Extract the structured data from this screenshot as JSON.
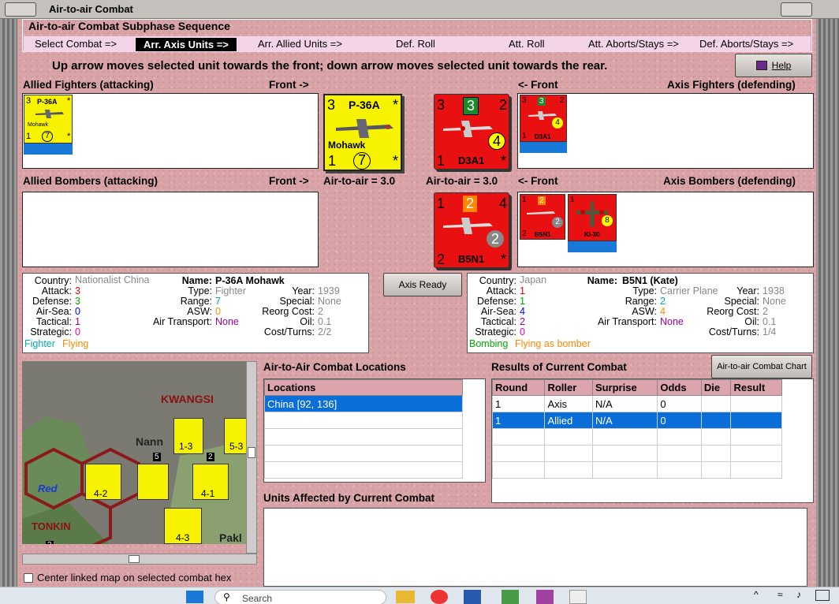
{
  "window": {
    "title": "Air-to-air Combat"
  },
  "sequence": {
    "title": "Air-to-air Combat Subphase Sequence",
    "steps": [
      "Select Combat =>",
      "Arr. Axis Units =>",
      "Arr. Allied Units =>",
      "Def. Roll",
      "Att. Roll",
      "Att. Aborts/Stays =>",
      "Def. Aborts/Stays =>"
    ],
    "active_step": "Arr. Axis Units =>"
  },
  "instructions": "Up arrow moves selected unit towards the front; down arrow moves selected unit towards the rear.",
  "help_button": "Help",
  "allied_fighters": {
    "label": "Allied Fighters (attacking)",
    "front": "Front ->"
  },
  "axis_fighters": {
    "label": "Axis Fighters (defending)",
    "front": "<- Front"
  },
  "allied_bombers": {
    "label": "Allied Bombers (attacking)",
    "front": "Front ->"
  },
  "axis_bombers": {
    "label": "Axis Bombers (defending)",
    "front": "<- Front"
  },
  "air_to_air_left": "Air-to-air = 3.0",
  "air_to_air_right": "Air-to-air = 3.0",
  "axis_ready_button": "Axis Ready",
  "chart_button": "Air-to-air Combat Chart",
  "units": {
    "p36a": {
      "attack": "3",
      "name": "P-36A",
      "star": "*",
      "nickname": "Mohawk",
      "bottom_left": "1",
      "range": "7"
    },
    "d3a1": {
      "top_left": "3",
      "green": "3",
      "top_right": "2",
      "yellow": "4",
      "bottom_left": "1",
      "name": "D3A1",
      "star": "*"
    },
    "b5n1": {
      "top_left": "1",
      "orange": "2",
      "top_right": "4",
      "grey": "2",
      "bottom_left": "2",
      "name": "B5N1",
      "star": "*"
    },
    "ki30": {
      "top_left": "1",
      "yellow": "8",
      "name": "Ki-30"
    }
  },
  "allied_info": {
    "labels": {
      "country": "Country:",
      "attack": "Attack:",
      "defense": "Defense:",
      "airsea": "Air-Sea:",
      "tactical": "Tactical:",
      "strategic": "Strategic:",
      "name": "Name:",
      "type": "Type:",
      "range": "Range:",
      "asw": "ASW:",
      "airtransport": "Air Transport:",
      "year": "Year:",
      "special": "Special:",
      "reorg": "Reorg Cost:",
      "oil": "Oil:",
      "cost": "Cost/Turns:"
    },
    "country": "Nationalist China",
    "attack": "3",
    "defense": "3",
    "airsea": "0",
    "tactical": "1",
    "strategic": "0",
    "name": "P-36A Mohawk",
    "type": "Fighter",
    "range": "7",
    "asw": "0",
    "airtransport": "None",
    "year": "1939",
    "special": "None",
    "reorg": "2",
    "oil": "0.1",
    "cost": "2/2",
    "role": "Fighter",
    "status": "Flying"
  },
  "axis_info": {
    "country": "Japan",
    "attack": "1",
    "defense": "1",
    "airsea": "4",
    "tactical": "2",
    "strategic": "0",
    "name": "B5N1 (Kate)",
    "type": "Carrier Plane",
    "range": "2",
    "asw": "4",
    "airtransport": "None",
    "year": "1938",
    "special": "None",
    "reorg": "2",
    "oil": "0.1",
    "cost": "1/4",
    "role": "Bombing",
    "status": "Flying as bomber"
  },
  "locations": {
    "title": "Air-to-Air Combat Locations",
    "header": "Locations",
    "rows": [
      "China [92, 136]"
    ]
  },
  "results": {
    "title": "Results of Current Combat",
    "headers": [
      "Round",
      "Roller",
      "Surprise",
      "Odds",
      "Die",
      "Result"
    ],
    "rows": [
      [
        "1",
        "Axis",
        "N/A",
        "0",
        "",
        ""
      ],
      [
        "1",
        "Allied",
        "N/A",
        "0",
        "",
        ""
      ]
    ]
  },
  "affected": {
    "title": "Units Affected by Current Combat"
  },
  "map": {
    "labels": {
      "kwangsi": "KWANGSI",
      "nann": "Nann",
      "red": "Red",
      "tonkin": "TONKIN",
      "pakl": "Pakl"
    },
    "counters": [
      "1-3",
      "5-3",
      "4-2",
      "4-1",
      "4-3"
    ],
    "stack_counts": [
      "5",
      "2",
      "2"
    ]
  },
  "center_checkbox": "Center linked map on selected combat hex",
  "taskbar": {
    "search": "Search"
  }
}
